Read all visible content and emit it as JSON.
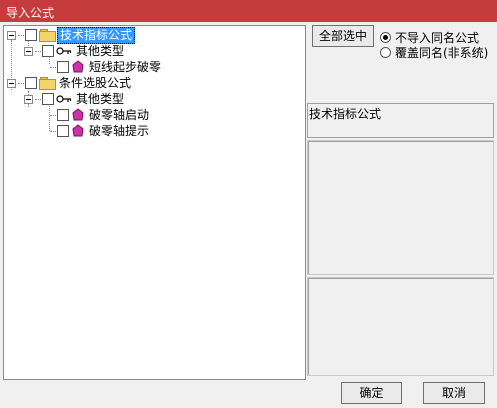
{
  "window": {
    "title": "导入公式"
  },
  "tree": {
    "nodes": [
      {
        "label": "技术指标公式",
        "selected": true
      },
      {
        "label": "其他类型"
      },
      {
        "label": "短线起步破零"
      },
      {
        "label": "条件选股公式"
      },
      {
        "label": "其他类型"
      },
      {
        "label": "破零轴启动"
      },
      {
        "label": "破零轴提示"
      }
    ]
  },
  "actions": {
    "select_all_label": "全部选中"
  },
  "options": {
    "selected": 0,
    "items": [
      {
        "label": "不导入同名公式"
      },
      {
        "label": "覆盖同名(非系统)"
      }
    ]
  },
  "info": {
    "heading": "技术指标公式"
  },
  "footer": {
    "ok_label": "确定",
    "cancel_label": "取消"
  }
}
